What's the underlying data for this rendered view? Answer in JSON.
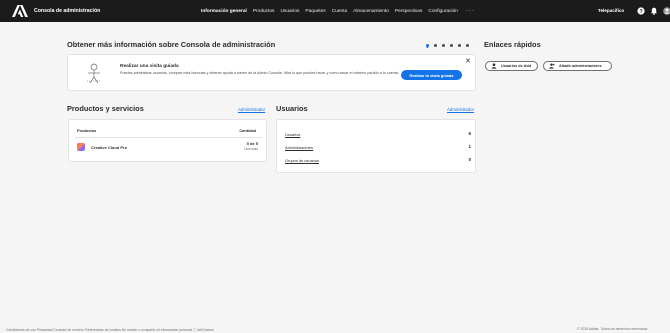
{
  "topbar": {
    "app_title": "Consola de administración",
    "nav": [
      {
        "label": "Información general",
        "active": true
      },
      {
        "label": "Productos",
        "active": false
      },
      {
        "label": "Usuarios",
        "active": false
      },
      {
        "label": "Paquetes",
        "active": false
      },
      {
        "label": "Cuenta",
        "active": false
      },
      {
        "label": "Almacenamiento",
        "active": false
      },
      {
        "label": "Perspectivas",
        "active": false
      },
      {
        "label": "Configuración",
        "active": false
      }
    ],
    "more": "···",
    "org_name": "Telepacifico",
    "icons": [
      "help-icon",
      "notifications-icon",
      "avatar"
    ]
  },
  "info": {
    "heading": "Obtener más información sobre Consola de administración",
    "carousel_dots": 6,
    "carousel_active": 0
  },
  "tour": {
    "title": "Realizar una visita guiada",
    "description": "Puedes administrar usuarios, comprar más licencias y obtener ayuda a través de la Admin Console. Mira lo que puedes hacer y cómo sacar el máximo partido a tu cuenta.",
    "button": "Realizar la visita guiada",
    "close": "✕"
  },
  "quick_links": {
    "heading": "Enlaces rápidos",
    "buttons": [
      "Usuarios de Add",
      "Añadir administradores"
    ]
  },
  "products": {
    "heading": "Productos y servicios",
    "link": "Administrador",
    "col_products": "Productos",
    "col_quantity": "Cantidad",
    "rows": [
      {
        "name": "Creative Cloud Pro",
        "quantity": "5 de 5",
        "unit": "Licencias"
      }
    ]
  },
  "users": {
    "heading": "Usuarios",
    "link": "Administrador",
    "rows": [
      {
        "label": "Usuarios",
        "value": "6"
      },
      {
        "label": "Administradores",
        "value": "1"
      },
      {
        "label": "Grupos de usuarios",
        "value": "0"
      }
    ]
  },
  "footer": {
    "links": "Condiciones de uso   Privacidad   Contrato de servicio   Preferencias de cookies   No vender o compartir mi información personal   ⓘ AdChoices",
    "copyright": "© 2025 Adobe. Todos los derechos reservados."
  },
  "colors": {
    "accent": "#1473e6",
    "topbar_bg": "#1b1b1b",
    "page_bg": "#f5f5f5"
  }
}
